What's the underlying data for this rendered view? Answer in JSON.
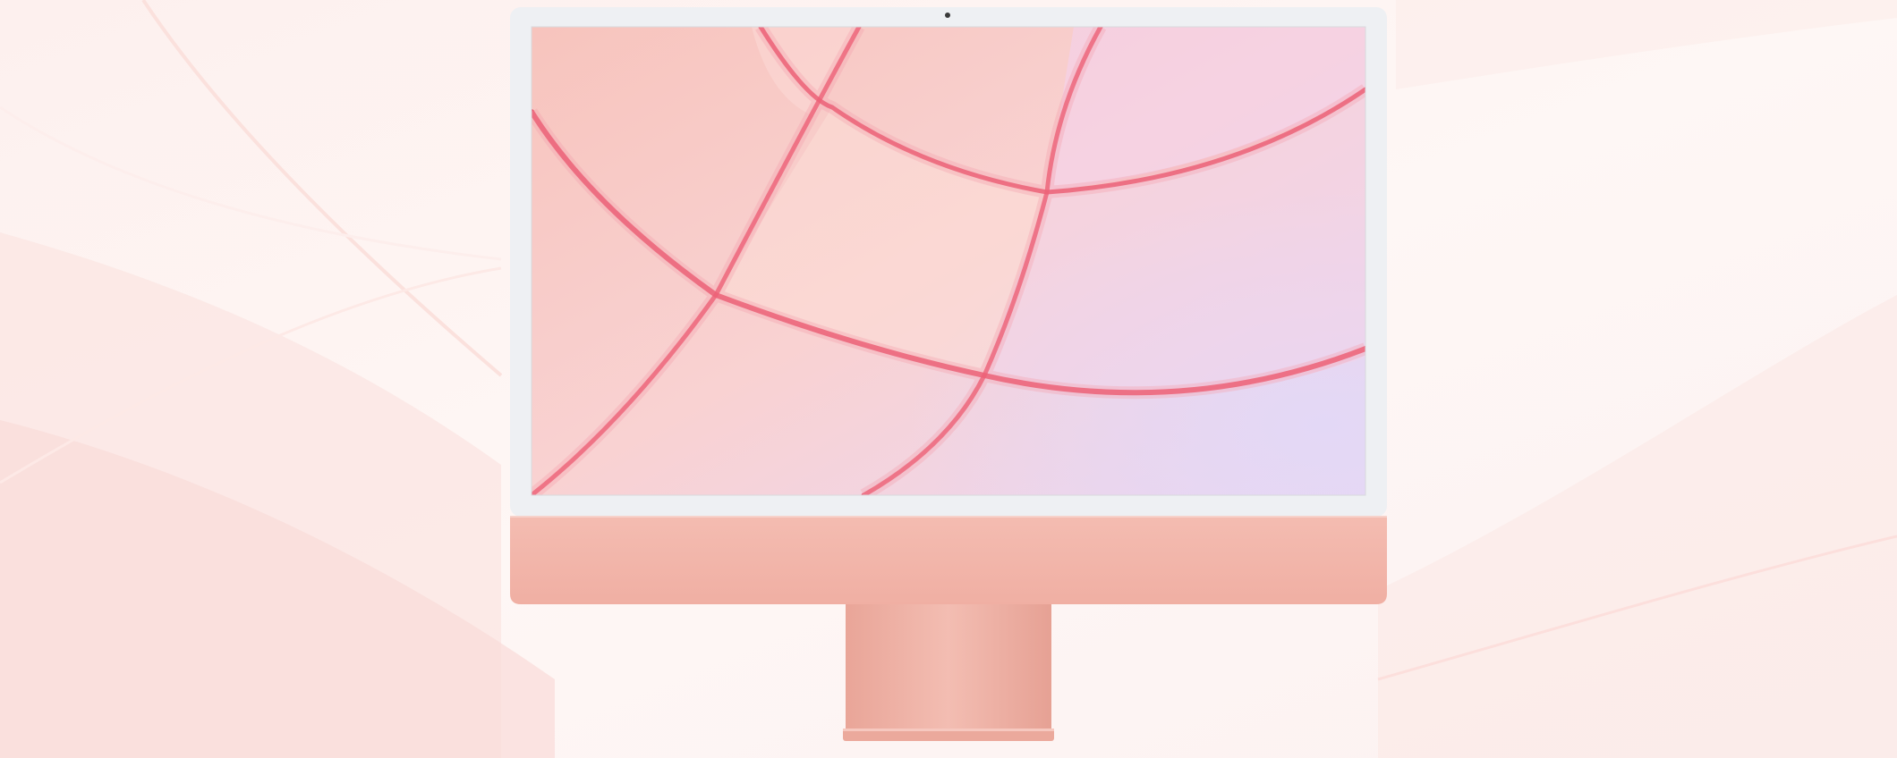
{
  "scene": {
    "subject": "iMac",
    "colors": {
      "background": "#fdf3f1",
      "background_wave": "#fbe4e2",
      "bezel": "#eef0f3",
      "chin": "#f2b3a8",
      "stand": "#eeb0a4",
      "wallpaper_base": "#f8c9c4",
      "wallpaper_line": "#e8405a",
      "wallpaper_lavender": "#e6d4f4"
    },
    "icons": [
      "camera-icon"
    ]
  }
}
